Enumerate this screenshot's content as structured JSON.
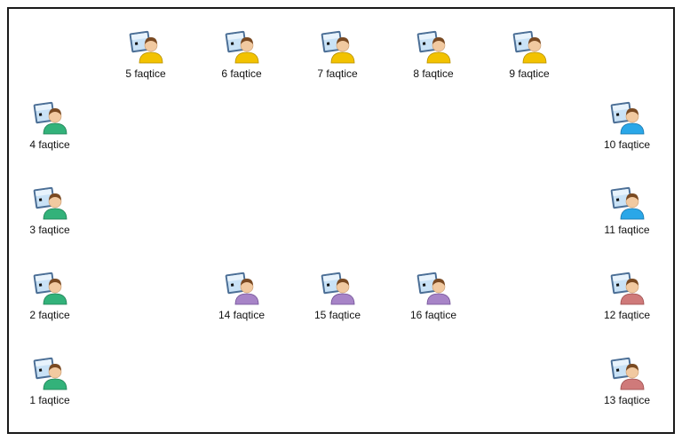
{
  "stations": [
    {
      "id": "5",
      "label": "5  faqtice",
      "shirt": "yellow"
    },
    {
      "id": "6",
      "label": "6  faqtice",
      "shirt": "yellow"
    },
    {
      "id": "7",
      "label": "7  faqtice",
      "shirt": "yellow"
    },
    {
      "id": "8",
      "label": "8  faqtice",
      "shirt": "yellow"
    },
    {
      "id": "9",
      "label": "9  faqtice",
      "shirt": "yellow"
    },
    {
      "id": "4",
      "label": "4  faqtice",
      "shirt": "green"
    },
    {
      "id": "10",
      "label": "10  faqtice",
      "shirt": "blue"
    },
    {
      "id": "3",
      "label": "3  faqtice",
      "shirt": "green"
    },
    {
      "id": "11",
      "label": "11  faqtice",
      "shirt": "blue"
    },
    {
      "id": "2",
      "label": "2  faqtice",
      "shirt": "green"
    },
    {
      "id": "14",
      "label": "14  faqtice",
      "shirt": "purple"
    },
    {
      "id": "15",
      "label": "15  faqtice",
      "shirt": "purple"
    },
    {
      "id": "16",
      "label": "16  faqtice",
      "shirt": "purple"
    },
    {
      "id": "12",
      "label": "12  faqtice",
      "shirt": "red"
    },
    {
      "id": "1",
      "label": "1  faqtice",
      "shirt": "green"
    },
    {
      "id": "13",
      "label": "13  faqtice",
      "shirt": "red"
    }
  ],
  "shirt_colors": {
    "yellow": {
      "main": "#f2c200",
      "dark": "#b58f00"
    },
    "green": {
      "main": "#33b27a",
      "dark": "#1e7d53"
    },
    "blue": {
      "main": "#2aa7e8",
      "dark": "#1673a8"
    },
    "purple": {
      "main": "#a784c7",
      "dark": "#6f4f94"
    },
    "red": {
      "main": "#cf7a7a",
      "dark": "#9a4a4a"
    }
  },
  "icon": "workstation-user-icon"
}
